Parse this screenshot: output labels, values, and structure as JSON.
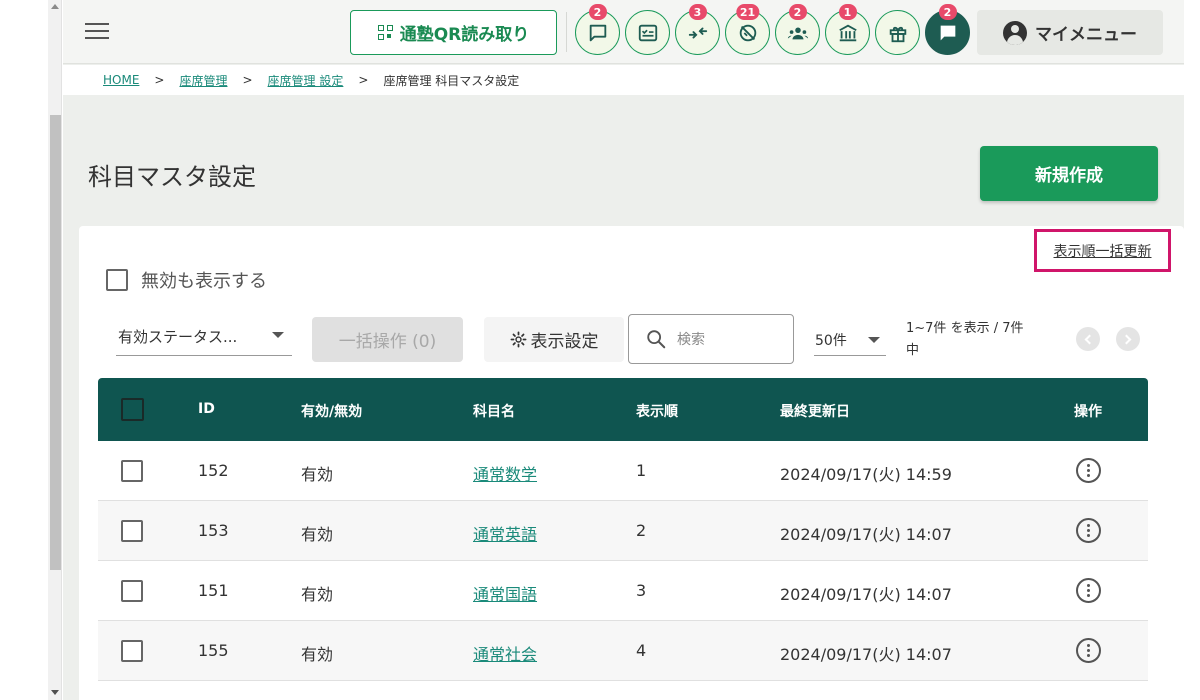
{
  "header": {
    "qr_button_label": "通塾QR読み取り",
    "icons": [
      {
        "name": "message-icon",
        "badge": "2"
      },
      {
        "name": "checklist-icon",
        "badge": ""
      },
      {
        "name": "arrows-in-icon",
        "badge": "3"
      },
      {
        "name": "no-check-icon",
        "badge": "21"
      },
      {
        "name": "group-icon",
        "badge": "2"
      },
      {
        "name": "school-icon",
        "badge": "1"
      },
      {
        "name": "gift-icon",
        "badge": ""
      },
      {
        "name": "chat-icon",
        "badge": "2"
      }
    ],
    "mymenu_label": "マイメニュー"
  },
  "breadcrumb": {
    "items": [
      "HOME",
      "座席管理",
      "座席管理 設定"
    ],
    "current": "座席管理 科目マスタ設定",
    "separator": ">"
  },
  "page": {
    "title": "科目マスタ設定",
    "new_button_label": "新規作成",
    "bulk_order_link": "表示順一括更新"
  },
  "filters": {
    "show_invalid_label": "無効も表示する",
    "status_select_value": "有効ステータス...",
    "bulk_op_label": "一括操作 (0)",
    "display_setting_label": "表示設定",
    "search_placeholder": "検索",
    "per_page_value": "50件",
    "range_text": "1~7件 を表示 / 7件中"
  },
  "table": {
    "columns": [
      "ID",
      "有効/無効",
      "科目名",
      "表示順",
      "最終更新日",
      "操作"
    ],
    "rows": [
      {
        "id": "152",
        "status": "有効",
        "name": "通常数学",
        "order": "1",
        "updated": "2024/09/17(火) 14:59"
      },
      {
        "id": "153",
        "status": "有効",
        "name": "通常英語",
        "order": "2",
        "updated": "2024/09/17(火) 14:07"
      },
      {
        "id": "151",
        "status": "有効",
        "name": "通常国語",
        "order": "3",
        "updated": "2024/09/17(火) 14:07"
      },
      {
        "id": "155",
        "status": "有効",
        "name": "通常社会",
        "order": "4",
        "updated": "2024/09/17(火) 14:07"
      }
    ]
  },
  "colors": {
    "brand_green": "#1a9a5a",
    "table_header": "#0f5550",
    "badge": "#e84a6a",
    "highlight_box": "#d0156a",
    "link": "#1a8a7a"
  }
}
